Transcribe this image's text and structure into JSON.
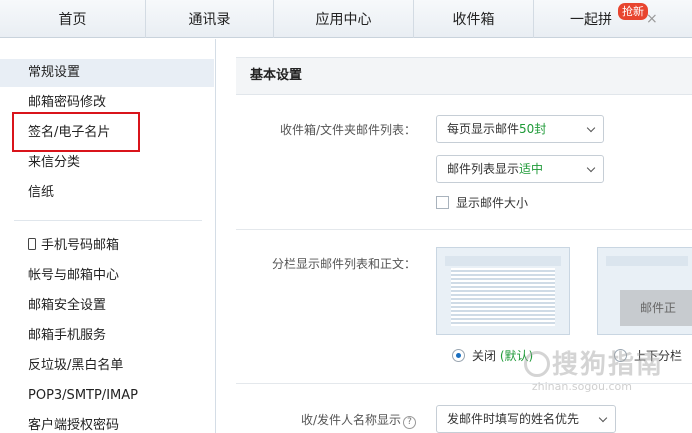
{
  "tabs": [
    {
      "label": "首页"
    },
    {
      "label": "通讯录"
    },
    {
      "label": "应用中心"
    },
    {
      "label": "收件箱"
    },
    {
      "label": "一起拼",
      "badge": "抢新",
      "close": "×"
    }
  ],
  "sidebar": {
    "items": [
      {
        "label": "常规设置"
      },
      {
        "label": "邮箱密码修改"
      },
      {
        "label": "签名/电子名片"
      },
      {
        "label": "来信分类"
      },
      {
        "label": "信纸"
      },
      {
        "label": "手机号码邮箱"
      },
      {
        "label": "帐号与邮箱中心"
      },
      {
        "label": "邮箱安全设置"
      },
      {
        "label": "邮箱手机服务"
      },
      {
        "label": "反垃圾/黑白名单"
      },
      {
        "label": "POP3/SMTP/IMAP"
      },
      {
        "label": "客户端授权密码"
      }
    ]
  },
  "main": {
    "section_title": "基本设置",
    "inbox_list_label": "收件箱/文件夹邮件列表：",
    "per_page_select": {
      "prefix": "每页显示邮件",
      "value": "50封"
    },
    "list_display_select": {
      "prefix": "邮件列表显示",
      "value": "适中"
    },
    "show_size_label": "显示邮件大小",
    "split_label": "分栏显示邮件列表和正文：",
    "preview_pane_label": "邮件正",
    "radio_off": {
      "label": "关闭",
      "note": "(默认)"
    },
    "radio_updown": {
      "label": "上下分栏"
    },
    "sender_name_label": "收/发件人名称显示",
    "sender_name_select": {
      "value": "发邮件时填写的姓名优先"
    }
  },
  "watermark": {
    "text": "搜狗指南",
    "sub": "zhinan.sogou.com"
  },
  "colors": {
    "accent_green": "#1f9a38",
    "highlight_red": "#d9141b",
    "badge_red": "#e8452f"
  },
  "icons": {
    "help": "?",
    "phone": "phone-icon"
  }
}
